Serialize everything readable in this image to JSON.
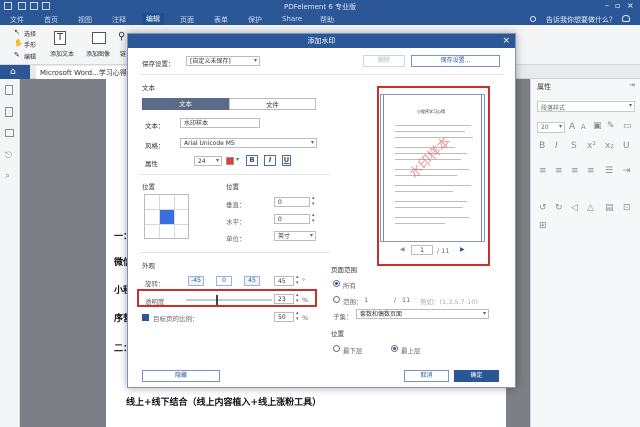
{
  "app": {
    "title": "PDFelement 6 专业版",
    "menu": [
      "文件",
      "首页",
      "视图",
      "注释",
      "编辑",
      "页面",
      "表单",
      "保护",
      "Share",
      "帮助"
    ],
    "active_menu": "编辑",
    "tell_me": "告诉我你想要做什么？"
  },
  "ribbon": {
    "tools": [
      "选择",
      "手形",
      "编辑"
    ],
    "add_text": "添加文本",
    "add_image": "添加图像",
    "link": "链"
  },
  "doc_tab": "Microsoft Word...学习心得",
  "document": {
    "lines": [
      "一：",
      "微信",
      "小程",
      "序营",
      "二：",
      "1.",
      "线上+线下结合（线上内容植入+线上涨粉工具）"
    ]
  },
  "right_panel": {
    "title": "属性",
    "style_select": "段落样式",
    "font_size": "20"
  },
  "dialog": {
    "title": "添加水印",
    "close": "×",
    "save_settings_label": "保存设置：",
    "save_settings_value": "[自定义未保存]",
    "delete_button": "删除",
    "save_settings_button": "保存设置...",
    "source_section": "文本",
    "source_tabs": [
      "文本",
      "文件"
    ],
    "active_source": "文本",
    "text_label": "文本：",
    "text_value": "水印样本",
    "style_label": "风格：",
    "font_value": "Arial Unicode MS",
    "attr_label": "属性",
    "size_value": "24",
    "bold": "B",
    "italic": "I",
    "underline": "U",
    "position_title": "位置",
    "position_right_title": "位置",
    "vertical_label": "垂直：",
    "vertical_value": "0",
    "horizontal_label": "水平：",
    "horizontal_value": "0",
    "unit_label": "单位：",
    "unit_value": "英寸",
    "appearance_title": "外观",
    "rotation_label": "旋转：",
    "rotation_presets": [
      "-45",
      "0",
      "45"
    ],
    "rotation_value": "45",
    "degree_symbol": "°",
    "opacity_label": "透明度",
    "opacity_value": "23",
    "percent_symbol": "%",
    "opacity_level": 0.23,
    "target_scale_label": "目标页的比例：",
    "target_scale_value": "50",
    "page_range_title": "页面范围",
    "all_label": "所有",
    "range_label": "范围：",
    "range_from": "1",
    "range_to_prefix": "/",
    "range_total": "11",
    "range_example": "例如：(1,3,5,7-10)",
    "subset_label": "子集：",
    "subset_value": "套数和偶数页面",
    "layer_title": "位置",
    "layer_bottom": "最下层",
    "layer_top": "最上层",
    "hide_button": "隐藏",
    "cancel_button": "取消",
    "ok_button": "确定",
    "preview": {
      "page_value": "1",
      "page_total": "/ 11",
      "prev": "◀",
      "next": "▶",
      "watermark_text": "水印样本",
      "doc_title": "小程序学习心得"
    }
  },
  "colors": {
    "brand": "#2b5797",
    "highlight_box": "#c9302c",
    "watermark_color": "#e23b3b"
  }
}
